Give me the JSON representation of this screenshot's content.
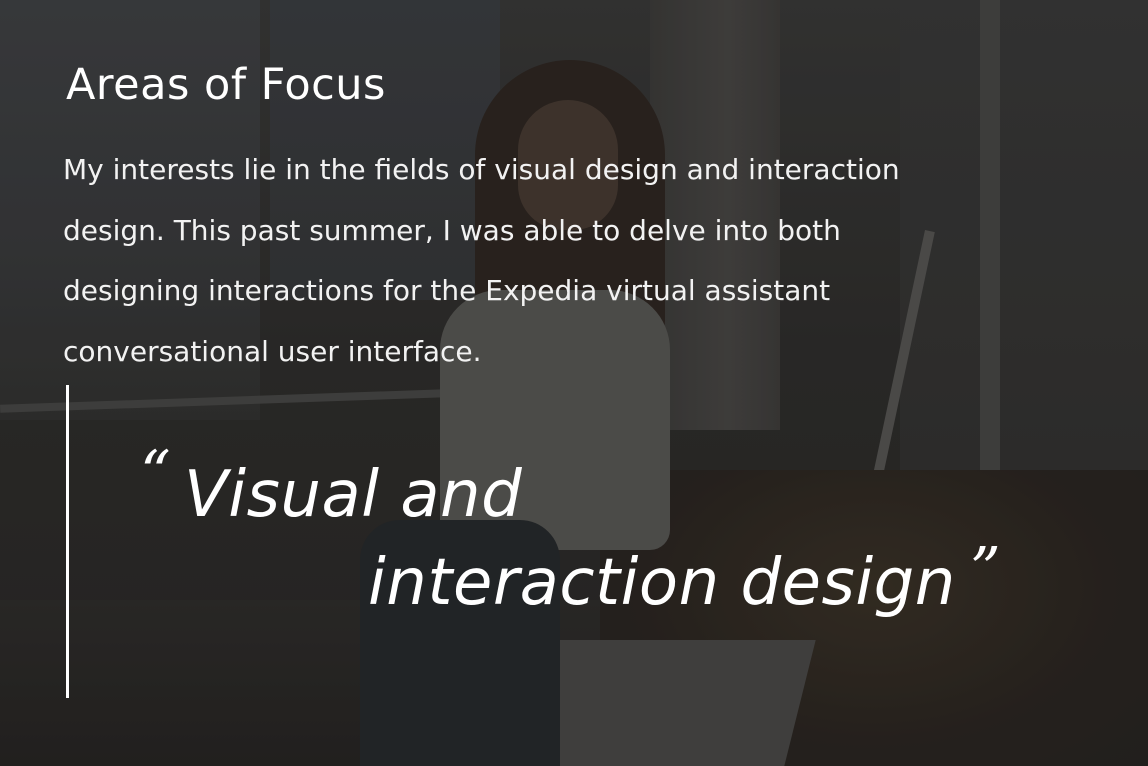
{
  "heading": "Areas of Focus",
  "body_lines": [
    "My interests lie in the fields of visual design and interaction",
    "design. This past summer, I was able to delve into both",
    "designing interactions for the Expedia virtual assistant",
    "conversational user interface."
  ],
  "quote": {
    "open_mark": "“",
    "line1": "Visual and",
    "line2": "interaction design",
    "close_mark": "”"
  },
  "colors": {
    "text": "#ffffff",
    "rule": "#ffffff"
  }
}
